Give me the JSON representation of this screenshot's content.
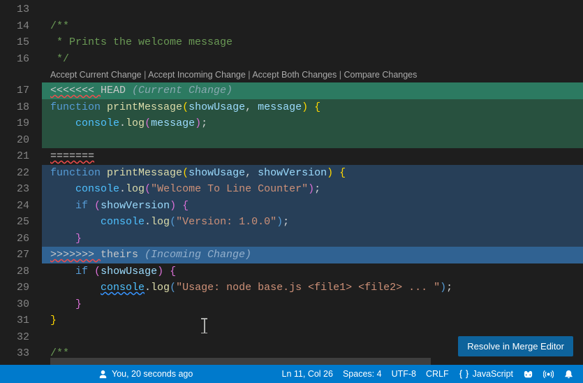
{
  "gutter": {
    "start": 13,
    "end": 33
  },
  "codelens": {
    "accept_current": "Accept Current Change",
    "accept_incoming": "Accept Incoming Change",
    "accept_both": "Accept Both Changes",
    "compare": "Compare Changes",
    "sep": " | "
  },
  "conflict": {
    "head_marker": "<<<<<<< ",
    "head_ref": "HEAD ",
    "head_label": "(Current Change)",
    "mid_marker": "=======",
    "theirs_marker": ">>>>>>> ",
    "theirs_ref": "theirs ",
    "theirs_label": "(Incoming Change)"
  },
  "tokens": {
    "doc_open": "/**",
    "doc_line": " * Prints the welcome message",
    "doc_close": " */",
    "function": "function",
    "printMessage": "printMessage",
    "showUsage": "showUsage",
    "message": "message",
    "showVersion": "showVersion",
    "console": "console",
    "log": "log",
    "if": "if",
    "str_welcome": "\"Welcome To Line Counter\"",
    "str_version": "\"Version: 1.0.0\"",
    "str_usage": "\"Usage: node base.js <file1> <file2> ... \""
  },
  "button": {
    "resolve": "Resolve in Merge Editor"
  },
  "status": {
    "blame": "You, 20 seconds ago",
    "cursor": "Ln 11, Col 26",
    "spaces": "Spaces: 4",
    "encoding": "UTF-8",
    "eol": "CRLF",
    "lang": "JavaScript"
  }
}
